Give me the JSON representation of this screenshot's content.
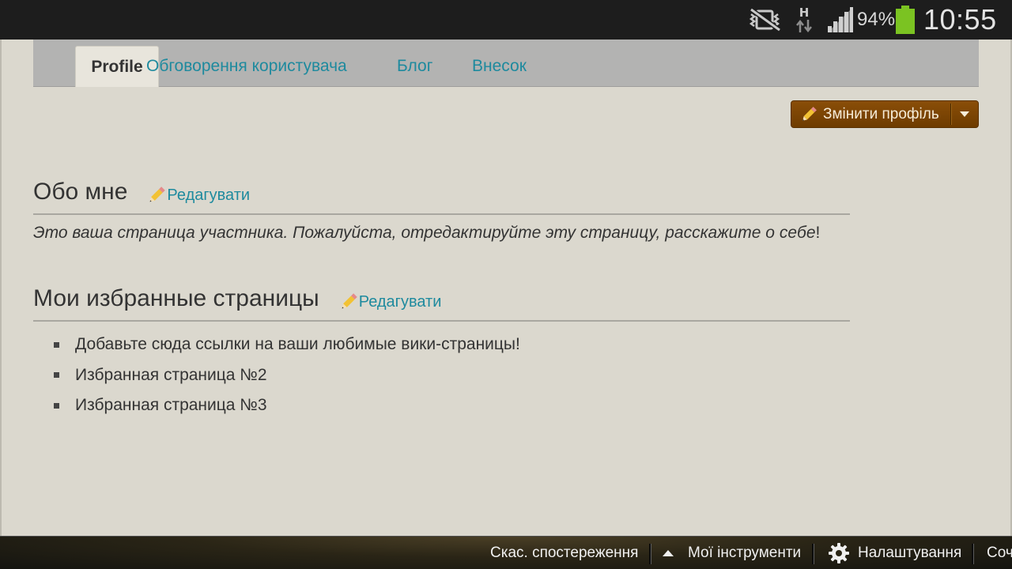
{
  "status_bar": {
    "network_type": "H",
    "battery_percent": "94%",
    "battery_level": 0.94,
    "time": "10:55",
    "icons": [
      "vibrate-mute-icon",
      "data-transfer-icon",
      "signal-icon",
      "battery-icon"
    ]
  },
  "tabs": [
    {
      "label": "Profile",
      "active": true
    },
    {
      "label": "Обговорення користувача",
      "active": false
    },
    {
      "label": "Блог",
      "active": false
    },
    {
      "label": "Внесок",
      "active": false
    }
  ],
  "edit_profile_button": {
    "label": "Змінити профіль"
  },
  "about": {
    "title": "Обо мне",
    "edit_label": "Редагувати",
    "text": "Это ваша страница участника. Пожалуйста, отредактируйте эту страницу, расскажите о себе",
    "text_end": "!"
  },
  "favorites": {
    "title": "Мои избранные страницы",
    "edit_label": "Редагувати",
    "items": [
      "Добавьте сюда ссылки на ваши любимые вики-страницы!",
      "Избранная страница №2",
      "Избранная страница №3"
    ]
  },
  "bottom_toolbar": {
    "unwatch": "Скас. спостереження",
    "my_tools": "Мої інструменти",
    "settings": "Налаштування",
    "partial": "Соч"
  },
  "colors": {
    "link": "#1e8a9e",
    "button": "#7a4400",
    "battery": "#7bc322",
    "background": "#dbd8ce"
  }
}
